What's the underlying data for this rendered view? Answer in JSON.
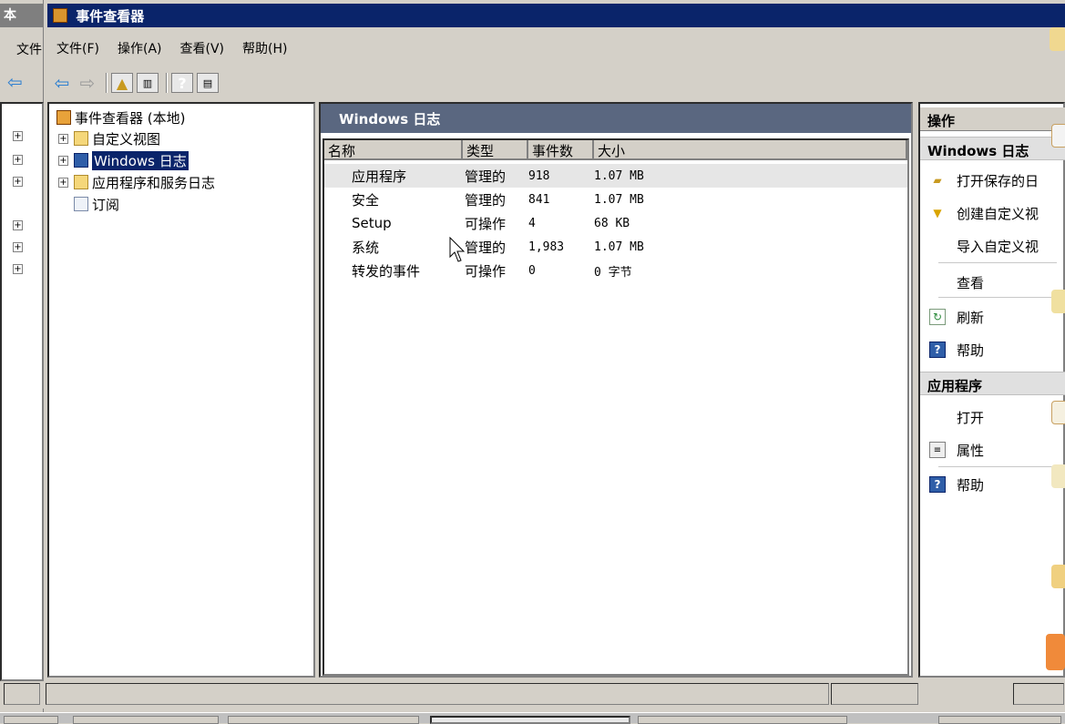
{
  "bg_window": {
    "title": "本",
    "menu_label": "文件"
  },
  "window": {
    "title": "事件查看器"
  },
  "menu": [
    "文件(F)",
    "操作(A)",
    "查看(V)",
    "帮助(H)"
  ],
  "tree": {
    "root": "事件查看器 (本地)",
    "items": [
      {
        "label": "自定义视图",
        "expandable": true,
        "icon": "folder-filter-icon"
      },
      {
        "label": "Windows 日志",
        "expandable": true,
        "selected": true,
        "icon": "windows-logs-folder-icon"
      },
      {
        "label": "应用程序和服务日志",
        "expandable": true,
        "icon": "app-service-logs-icon"
      },
      {
        "label": "订阅",
        "expandable": false,
        "icon": "subscription-icon"
      }
    ]
  },
  "middle": {
    "header": "Windows 日志",
    "columns": [
      "名称",
      "类型",
      "事件数",
      "大小"
    ],
    "rows": [
      {
        "name": "应用程序",
        "type": "管理的",
        "count": "918",
        "size": "1.07 MB"
      },
      {
        "name": "安全",
        "type": "管理的",
        "count": "841",
        "size": "1.07 MB"
      },
      {
        "name": "Setup",
        "type": "可操作",
        "count": "4",
        "size": "68 KB"
      },
      {
        "name": "系统",
        "type": "管理的",
        "count": "1,983",
        "size": "1.07 MB"
      },
      {
        "name": "转发的事件",
        "type": "可操作",
        "count": "0",
        "size": "0 字节"
      }
    ]
  },
  "actions": {
    "title": "操作",
    "section1": "Windows 日志",
    "items1": [
      {
        "label": "打开保存的日",
        "icon": "open-folder-icon"
      },
      {
        "label": "创建自定义视",
        "icon": "filter-icon"
      },
      {
        "label": "导入自定义视",
        "icon": ""
      },
      {
        "label": "查看",
        "icon": ""
      },
      {
        "label": "刷新",
        "icon": "refresh-icon"
      },
      {
        "label": "帮助",
        "icon": "help-icon"
      }
    ],
    "section2": "应用程序",
    "items2": [
      {
        "label": "打开",
        "icon": ""
      },
      {
        "label": "属性",
        "icon": "properties-icon"
      },
      {
        "label": "帮助",
        "icon": "help-icon"
      }
    ]
  },
  "colors": {
    "title_bar": "#0a246a",
    "pane_header": "#5a6780",
    "face": "#d4d0c8"
  }
}
